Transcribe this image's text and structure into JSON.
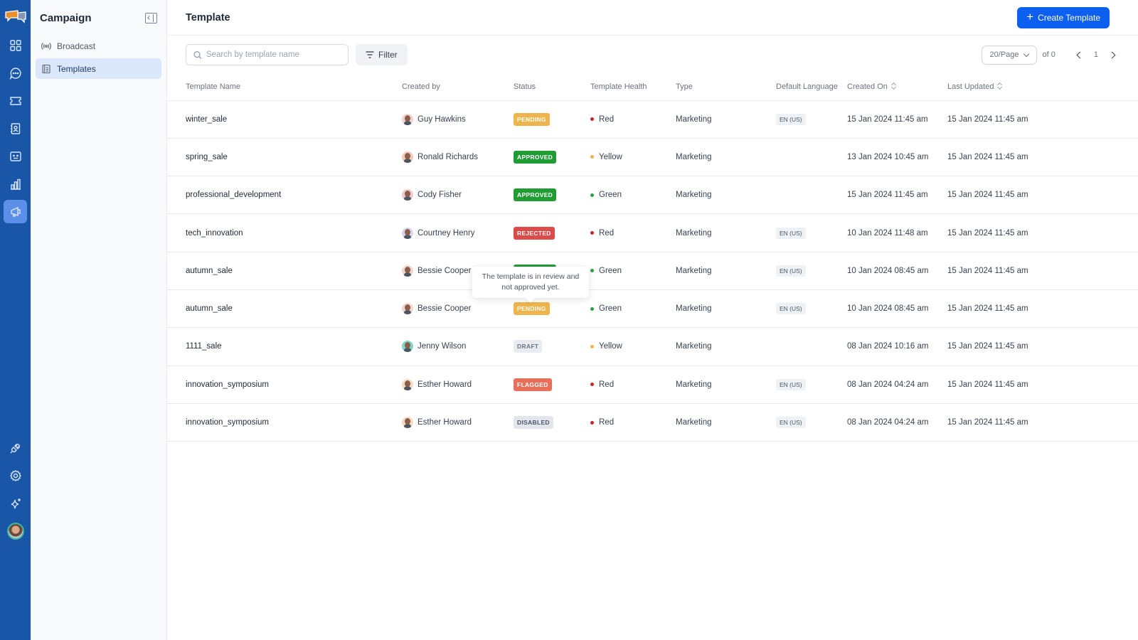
{
  "rail": {
    "items": [
      {
        "name": "dashboard-icon"
      },
      {
        "name": "chat-icon"
      },
      {
        "name": "ticket-icon"
      },
      {
        "name": "contacts-icon"
      },
      {
        "name": "bot-icon"
      },
      {
        "name": "analytics-icon"
      },
      {
        "name": "campaign-megaphone-icon",
        "active": true
      }
    ],
    "bottom_items": [
      {
        "name": "integrations-plug-icon"
      },
      {
        "name": "settings-gear-icon"
      },
      {
        "name": "ai-sparkle-icon"
      }
    ]
  },
  "subnav": {
    "title": "Campaign",
    "items": [
      {
        "label": "Broadcast",
        "icon": "broadcast-icon",
        "active": false
      },
      {
        "label": "Templates",
        "icon": "templates-icon",
        "active": true
      }
    ]
  },
  "header": {
    "title": "Template",
    "create_label": "Create Template"
  },
  "toolbar": {
    "search_placeholder": "Search by template name",
    "search_value": "",
    "filter_label": "Filter",
    "per_page": "20/Page",
    "of_total": "of 0",
    "page": "1"
  },
  "table": {
    "columns": [
      "Template Name",
      "Created by",
      "Status",
      "Template Health",
      "Type",
      "Default Language",
      "Created On",
      "Last Updated"
    ],
    "rows": [
      {
        "name": "winter_sale",
        "creator": "Guy Hawkins",
        "status": "PENDING",
        "health": "Red",
        "type": "Marketing",
        "lang": "EN (US)",
        "created": "15 Jan 2024 11:45 am",
        "updated": "15 Jan 2024 11:45 am"
      },
      {
        "name": "spring_sale",
        "creator": "Ronald Richards",
        "status": "APPROVED",
        "health": "Yellow",
        "type": "Marketing",
        "lang": "",
        "created": "13 Jan 2024 10:45 am",
        "updated": "15 Jan 2024 11:45 am"
      },
      {
        "name": "professional_development",
        "creator": "Cody Fisher",
        "status": "APPROVED",
        "health": "Green",
        "type": "Marketing",
        "lang": "",
        "created": "15 Jan 2024 11:45 am",
        "updated": "15 Jan 2024 11:45 am"
      },
      {
        "name": "tech_innovation",
        "creator": "Courtney Henry",
        "status": "REJECTED",
        "health": "Red",
        "type": "Marketing",
        "lang": "EN (US)",
        "created": "10 Jan 2024 11:48 am",
        "updated": "15 Jan 2024 11:45 am"
      },
      {
        "name": "autumn_sale",
        "creator": "Bessie Cooper",
        "status": "APPROVED",
        "health": "Green",
        "type": "Marketing",
        "lang": "EN (US)",
        "created": "10 Jan 2024 08:45 am",
        "updated": "15 Jan 2024 11:45 am"
      },
      {
        "name": "autumn_sale",
        "creator": "Bessie Cooper",
        "status": "PENDING",
        "health": "Green",
        "type": "Marketing",
        "lang": "EN (US)",
        "created": "10 Jan 2024 08:45 am",
        "updated": "15 Jan 2024 11:45 am"
      },
      {
        "name": "1111_sale",
        "creator": "Jenny Wilson",
        "status": "DRAFT",
        "health": "Yellow",
        "type": "Marketing",
        "lang": "",
        "created": "08 Jan 2024 10:16 am",
        "updated": "15 Jan 2024 11:45 am"
      },
      {
        "name": "innovation_symposium",
        "creator": "Esther Howard",
        "status": "FLAGGED",
        "health": "Red",
        "type": "Marketing",
        "lang": "EN (US)",
        "created": "08 Jan 2024 04:24 am",
        "updated": "15 Jan 2024 11:45 am"
      },
      {
        "name": "innovation_symposium",
        "creator": "Esther Howard",
        "status": "DISABLED",
        "health": "Red",
        "type": "Marketing",
        "lang": "EN (US)",
        "created": "08 Jan 2024 04:24 am",
        "updated": "15 Jan 2024 11:45 am"
      }
    ]
  },
  "tooltip": {
    "text": "The template is in review and not approved yet."
  },
  "colors": {
    "rail_bg": "#1a56a8",
    "primary": "#0d5ff0",
    "status": {
      "PENDING": {
        "bg": "#f0b44c",
        "fg": "#ffffff"
      },
      "APPROVED": {
        "bg": "#1f9d33",
        "fg": "#ffffff"
      },
      "REJECTED": {
        "bg": "#dc4a4a",
        "fg": "#ffffff"
      },
      "FLAGGED": {
        "bg": "#e8705a",
        "fg": "#ffffff"
      },
      "DRAFT": {
        "bg": "#e8ebf0",
        "fg": "#6b7280"
      },
      "DISABLED": {
        "bg": "#e2e6ec",
        "fg": "#4b5563"
      }
    },
    "health": {
      "Red": "#c62828",
      "Yellow": "#f0b44c",
      "Green": "#2e9e44"
    },
    "avatars": [
      "#f3d4d4",
      "#f5c9b5",
      "#f0c8d2",
      "#d9d4f0",
      "#f1d7cf",
      "#f1d7cf",
      "#7fd6c6",
      "#f6dcc0",
      "#f6dcc0"
    ]
  }
}
